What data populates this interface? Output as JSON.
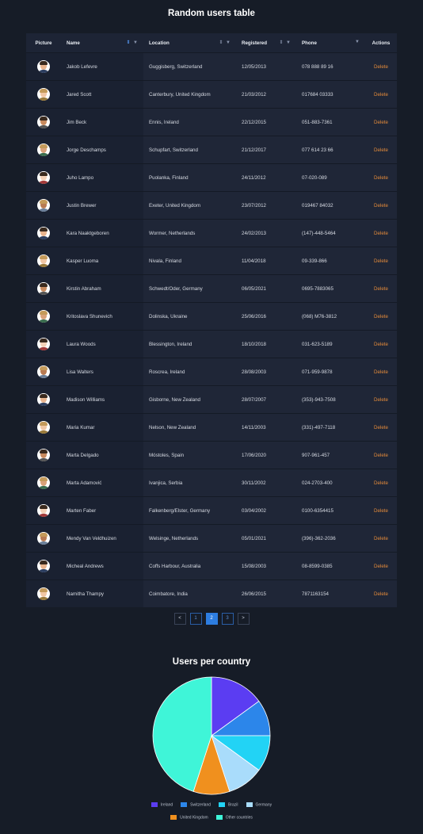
{
  "page_title": "Random users table",
  "table": {
    "headers": {
      "picture": "Picture",
      "name": "Name",
      "location": "Location",
      "registered": "Registered",
      "phone": "Phone",
      "actions": "Actions"
    },
    "sort_icon": "sort-updown-icon",
    "filter_icon": "filter-funnel-icon",
    "active_sort_column": "name",
    "action_label": "Delete",
    "rows": [
      {
        "name": "Jakob Lefevre",
        "location": "Guggisberg, Switzerland",
        "registered": "12/05/2013",
        "phone": "078 888 89 16"
      },
      {
        "name": "Jared Scott",
        "location": "Canterbury, United Kingdom",
        "registered": "21/03/2012",
        "phone": "017684 03333"
      },
      {
        "name": "Jim Beck",
        "location": "Ennis, Ireland",
        "registered": "22/12/2015",
        "phone": "051-883-7361"
      },
      {
        "name": "Jorge Deschamps",
        "location": "Schupfart, Switzerland",
        "registered": "21/12/2017",
        "phone": "077 614 23 66"
      },
      {
        "name": "Juho Lampo",
        "location": "Puolanka, Finland",
        "registered": "24/11/2012",
        "phone": "07-020-089"
      },
      {
        "name": "Justin Brewer",
        "location": "Exeter, United Kingdom",
        "registered": "23/07/2012",
        "phone": "019467 84032"
      },
      {
        "name": "Kara Naaktgeboren",
        "location": "Wormer, Netherlands",
        "registered": "24/02/2013",
        "phone": "(147)-448-5464"
      },
      {
        "name": "Kasper Luoma",
        "location": "Nivala, Finland",
        "registered": "11/04/2018",
        "phone": "09-339-866"
      },
      {
        "name": "Kirstin Abraham",
        "location": "Schwedt/Oder, Germany",
        "registered": "06/05/2021",
        "phone": "0695-7883065"
      },
      {
        "name": "Kritoslava Shunevich",
        "location": "Dolinska, Ukraine",
        "registered": "25/06/2016",
        "phone": "(068) M76-3812"
      },
      {
        "name": "Laura Woods",
        "location": "Blessington, Ireland",
        "registered": "18/10/2018",
        "phone": "031-623-5189"
      },
      {
        "name": "Lisa Walters",
        "location": "Roscrea, Ireland",
        "registered": "28/08/2003",
        "phone": "071-959-9878"
      },
      {
        "name": "Madison Williams",
        "location": "Gisborne, New Zealand",
        "registered": "28/07/2007",
        "phone": "(353)-943-7508"
      },
      {
        "name": "Maria Kumar",
        "location": "Nelson, New Zealand",
        "registered": "14/11/2003",
        "phone": "(331)-497-7118"
      },
      {
        "name": "Marta Delgado",
        "location": "Móstoles, Spain",
        "registered": "17/06/2020",
        "phone": "907-961-457"
      },
      {
        "name": "Marta Adamović",
        "location": "Ivanjica, Serbia",
        "registered": "30/11/2002",
        "phone": "024-2703-400"
      },
      {
        "name": "Marten Faber",
        "location": "Falkenberg/Elster, Germany",
        "registered": "03/04/2002",
        "phone": "0100-6354415"
      },
      {
        "name": "Mendy Van Veldhuizen",
        "location": "Welsinge, Netherlands",
        "registered": "05/01/2021",
        "phone": "(396)-362-2036"
      },
      {
        "name": "Micheal Andrews",
        "location": "Coffs Harbour, Australia",
        "registered": "15/08/2003",
        "phone": "08-8599-0385"
      },
      {
        "name": "Namitha Thampy",
        "location": "Coimbatore, India",
        "registered": "26/06/2015",
        "phone": "7871163154"
      }
    ]
  },
  "pagination": {
    "prev_label": "<",
    "next_label": ">",
    "pages": [
      "1",
      "2",
      "3"
    ],
    "current_page": "2"
  },
  "chart_title": "Users per country",
  "chart_data": {
    "type": "pie",
    "title": "Users per country",
    "labels": [
      "Ireland",
      "Switzerland",
      "Brazil",
      "Germany",
      "United Kingdom",
      "Other countries"
    ],
    "values": [
      3,
      2,
      2,
      2,
      2,
      9
    ],
    "colors": [
      "#5b3df2",
      "#2c86ea",
      "#22d3f5",
      "#a9dcfb",
      "#f0901e",
      "#3ff5d8"
    ],
    "legend_position": "bottom"
  }
}
